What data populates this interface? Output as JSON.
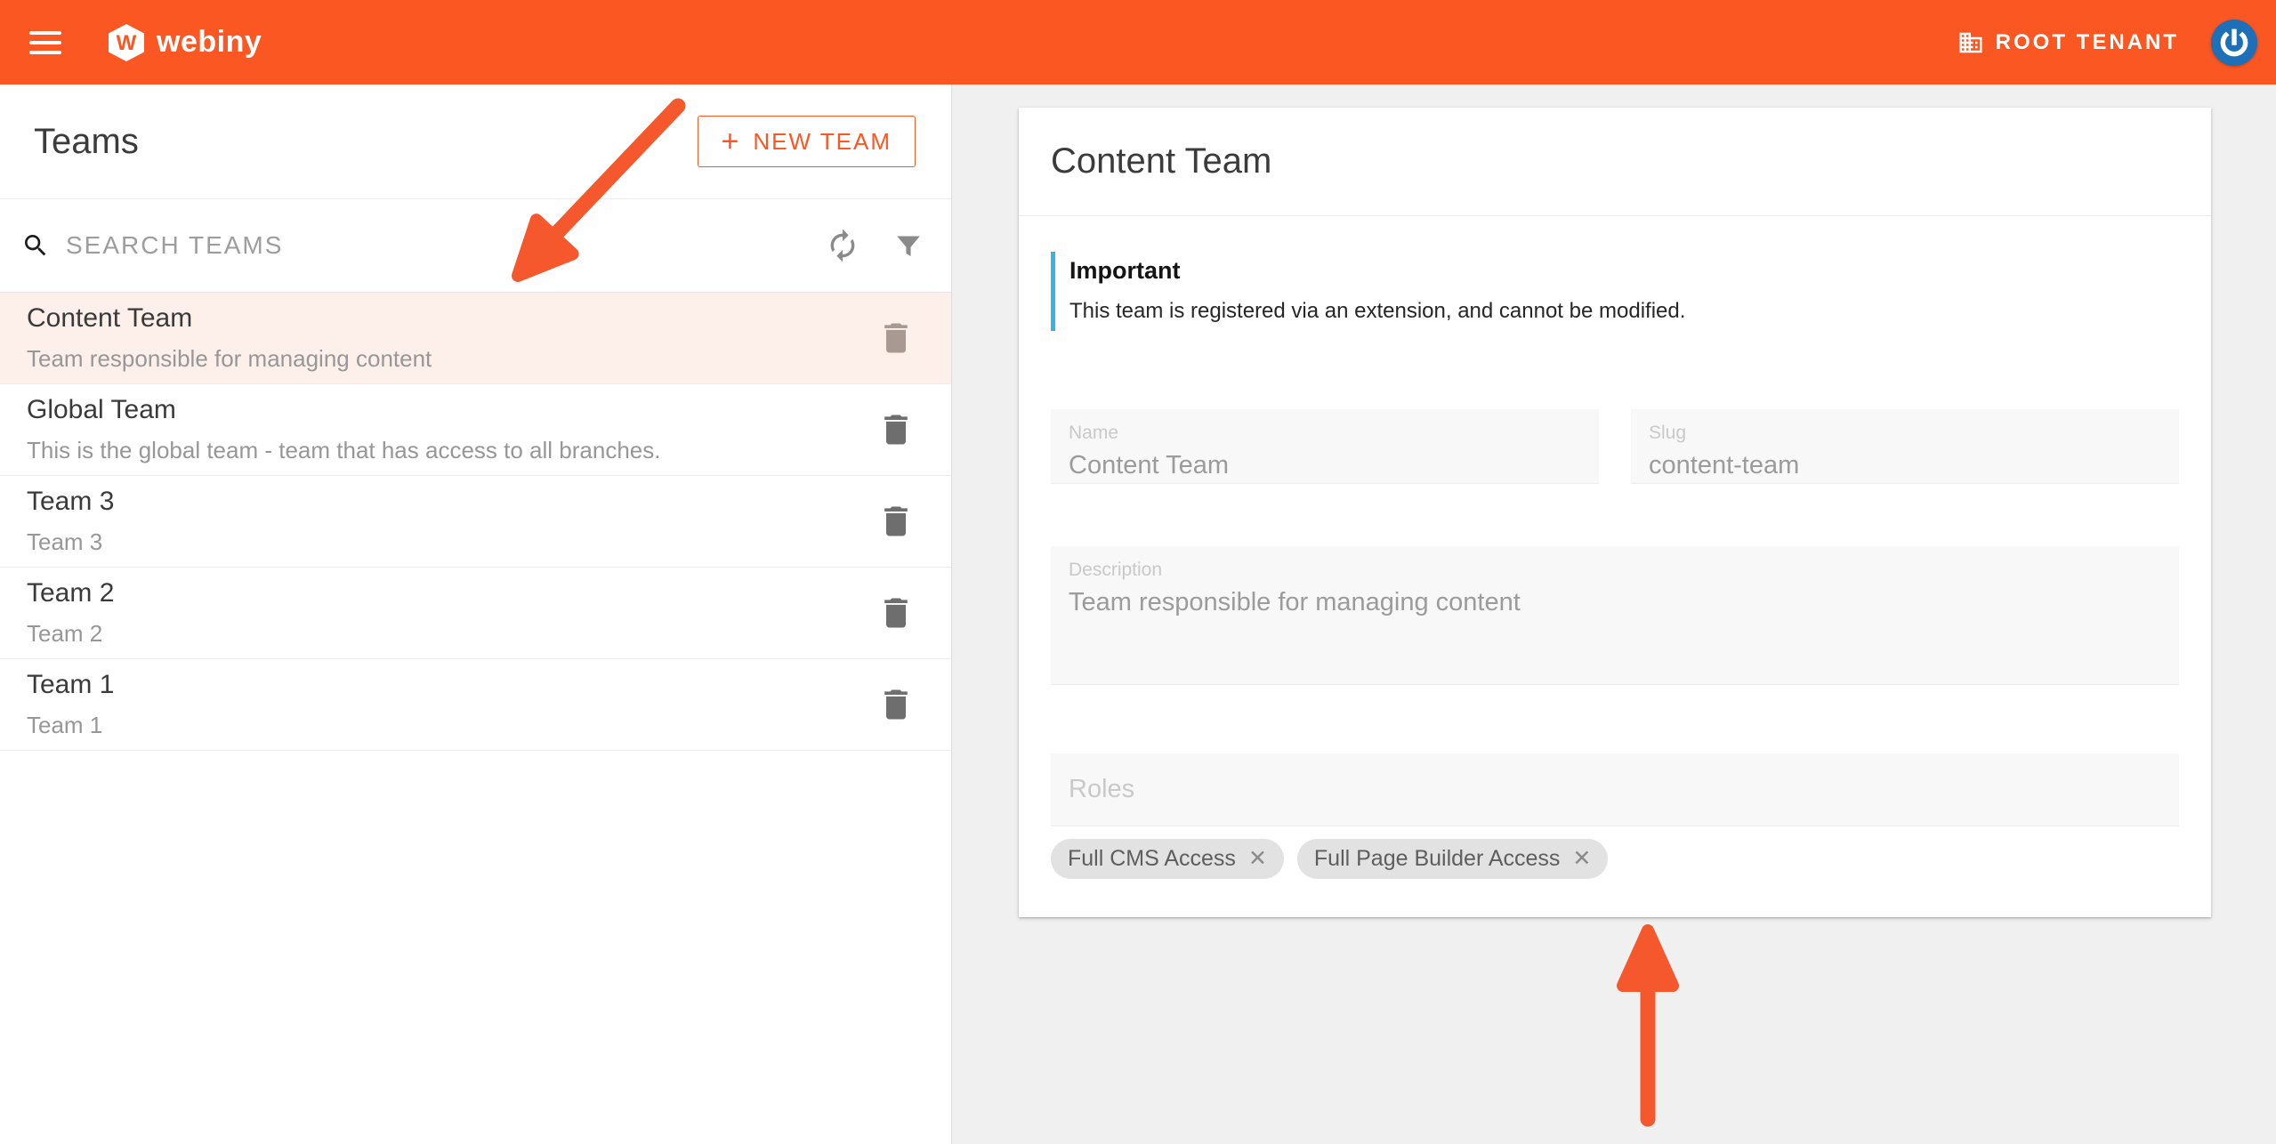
{
  "colors": {
    "accent": "#fa5723",
    "arrow": "#f4582c",
    "topbar_bg": "#fa5723",
    "selected_row_bg": "#fdf0ea",
    "notice_bar": "#38b2e4",
    "avatar_bg": "#1d70b8",
    "panel_bg": "#f0f0f0"
  },
  "header": {
    "brand": "webiny",
    "logo_letter": "W",
    "tenant_label": "ROOT TENANT"
  },
  "left_panel": {
    "title": "Teams",
    "new_team_plus": "+",
    "new_team_label": "NEW TEAM",
    "search_placeholder": "SEARCH TEAMS",
    "teams": [
      {
        "name": "Content Team",
        "description": "Team responsible for managing content"
      },
      {
        "name": "Global Team",
        "description": "This is the global team - team that has access to all branches."
      },
      {
        "name": "Team 3",
        "description": "Team 3"
      },
      {
        "name": "Team 2",
        "description": "Team 2"
      },
      {
        "name": "Team 1",
        "description": "Team 1"
      }
    ]
  },
  "detail": {
    "title": "Content Team",
    "notice": {
      "title": "Important",
      "body": "This team is registered via an extension, and cannot be modified."
    },
    "fields": {
      "name": {
        "label": "Name",
        "value": "Content Team"
      },
      "slug": {
        "label": "Slug",
        "value": "content-team"
      },
      "description": {
        "label": "Description",
        "value": "Team responsible for managing content"
      },
      "roles": {
        "label": "Roles"
      }
    },
    "role_chips": [
      {
        "label": "Full CMS Access"
      },
      {
        "label": "Full Page Builder Access"
      }
    ],
    "chip_remove_glyph": "✕"
  }
}
